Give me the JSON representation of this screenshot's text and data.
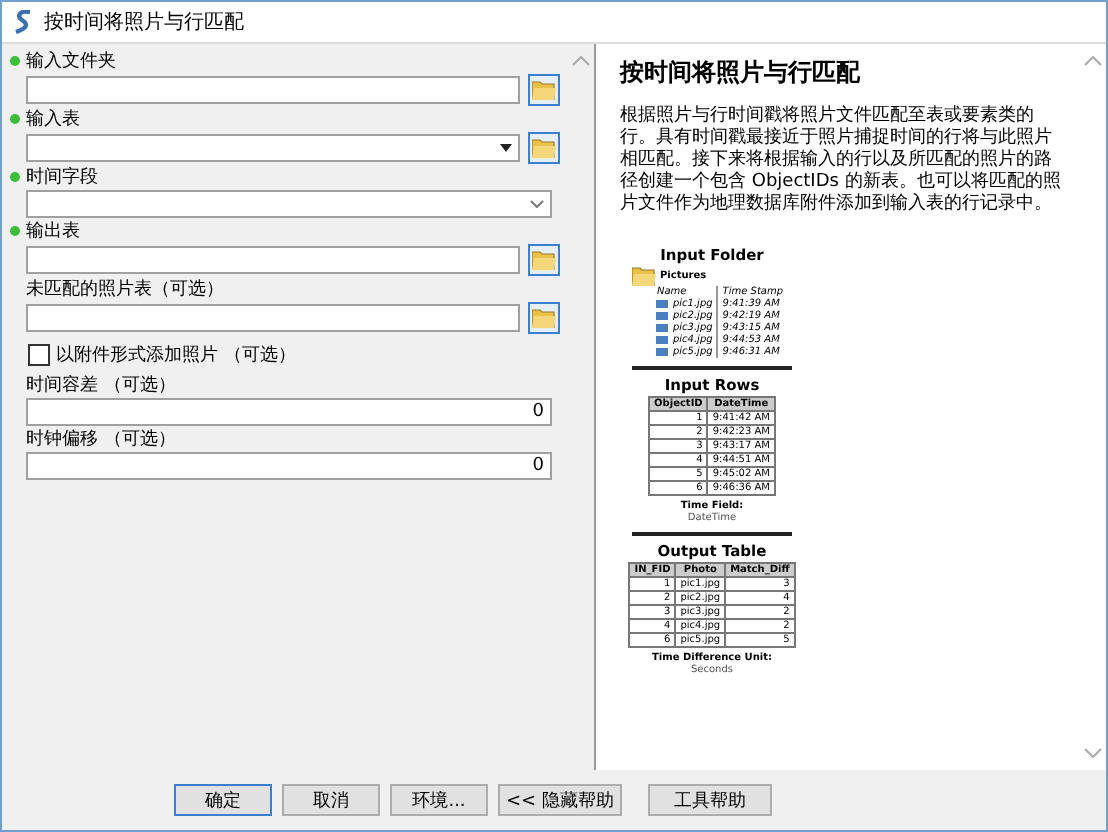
{
  "window": {
    "title": "按时间将照片与行匹配"
  },
  "parameters": [
    {
      "kind": "browse",
      "label": "输入文件夹",
      "required": true
    },
    {
      "kind": "combo-browse",
      "label": "输入表",
      "required": true
    },
    {
      "kind": "dropdown",
      "label": "时间字段",
      "required": true
    },
    {
      "kind": "browse",
      "label": "输出表",
      "required": true
    },
    {
      "kind": "browse",
      "label": "未匹配的照片表（可选）",
      "required": false
    },
    {
      "kind": "checkbox",
      "label": "以附件形式添加照片 （可选）",
      "checked": false
    },
    {
      "kind": "number",
      "label": "时间容差 （可选）",
      "required": false,
      "value": "0"
    },
    {
      "kind": "number",
      "label": "时钟偏移 （可选）",
      "required": false,
      "value": "0"
    }
  ],
  "help": {
    "title": "按时间将照片与行匹配",
    "description": "根据照片与行时间戳将照片文件匹配至表或要素类的行。具有时间戳最接近于照片捕捉时间的行将与此照片相匹配。接下来将根据输入的行以及所匹配的照片的路径创建一个包含 ObjectIDs 的新表。也可以将匹配的照片文件作为地理数据库附件添加到输入表的行记录中。",
    "input_folder": {
      "title": "Input Folder",
      "folder": "Pictures",
      "columns": [
        "Name",
        "Time Stamp"
      ],
      "rows": [
        [
          "pic1.jpg",
          "9:41:39 AM"
        ],
        [
          "pic2.jpg",
          "9:42:19 AM"
        ],
        [
          "pic3.jpg",
          "9:43:15 AM"
        ],
        [
          "pic4.jpg",
          "9:44:53 AM"
        ],
        [
          "pic5.jpg",
          "9:46:31 AM"
        ]
      ]
    },
    "input_rows": {
      "title": "Input Rows",
      "columns": [
        "ObjectID",
        "DateTime"
      ],
      "rows": [
        [
          "1",
          "9:41:42 AM"
        ],
        [
          "2",
          "9:42:23 AM"
        ],
        [
          "3",
          "9:43:17 AM"
        ],
        [
          "4",
          "9:44:51 AM"
        ],
        [
          "5",
          "9:45:02 AM"
        ],
        [
          "6",
          "9:46:36 AM"
        ]
      ],
      "note_label": "Time Field:",
      "note_value": "DateTime"
    },
    "output_table": {
      "title": "Output Table",
      "columns": [
        "IN_FID",
        "Photo",
        "Match_Diff"
      ],
      "rows": [
        [
          "1",
          "pic1.jpg",
          "3"
        ],
        [
          "2",
          "pic2.jpg",
          "4"
        ],
        [
          "3",
          "pic3.jpg",
          "2"
        ],
        [
          "4",
          "pic4.jpg",
          "2"
        ],
        [
          "6",
          "pic5.jpg",
          "5"
        ]
      ],
      "note_label": "Time Difference Unit:",
      "note_value": "Seconds"
    }
  },
  "buttons": [
    {
      "label": "确定",
      "default": true
    },
    {
      "label": "取消",
      "default": false
    },
    {
      "label": "环境...",
      "default": false
    },
    {
      "label": "<< 隐藏帮助",
      "default": false
    },
    {
      "label": "工具帮助",
      "default": false
    }
  ]
}
